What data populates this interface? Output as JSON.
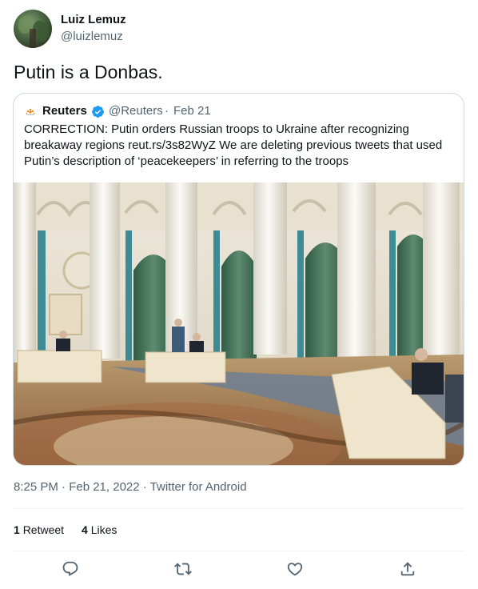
{
  "author": {
    "name": "Luiz Lemuz",
    "handle": "@luizlemuz",
    "avatar_icon": "profile-photo-foliage"
  },
  "tweet": {
    "text": "Putin is a Donbas."
  },
  "quoted": {
    "name": "Reuters",
    "handle": "@Reuters",
    "separator": "·",
    "date": "Feb 21",
    "verified_color": "#1d9bf0",
    "body_lines": [
      "CORRECTION: Putin orders Russian troops to Ukraine after recognizing",
      "breakaway regions reut.rs/3s82WyZ We are deleting previous tweets that used",
      "Putin’s description of ‘peacekeepers’ in referring to the troops"
    ],
    "photo_alt_icon": "kremlin-hall-photo"
  },
  "meta": {
    "text": "8:25 PM · Feb 21, 2022 · Twitter for Android"
  },
  "stats": {
    "retweets_count": "1",
    "retweets_label": "Retweet",
    "likes_count": "4",
    "likes_label": "Likes"
  },
  "actions": [
    {
      "name": "reply-icon"
    },
    {
      "name": "retweet-icon"
    },
    {
      "name": "like-icon"
    },
    {
      "name": "share-icon"
    }
  ],
  "colors": {
    "text_primary": "#0f1419",
    "text_secondary": "#536471",
    "border": "#cfd9de",
    "accent": "#1d9bf0"
  }
}
